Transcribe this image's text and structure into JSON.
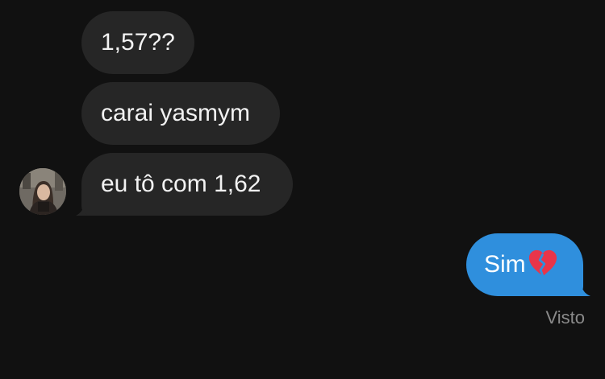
{
  "messages": [
    {
      "direction": "incoming",
      "text": "1,57??"
    },
    {
      "direction": "incoming",
      "text": "carai yasmym"
    },
    {
      "direction": "incoming",
      "text": "eu tô com 1,62"
    },
    {
      "direction": "outgoing",
      "text": "Sim",
      "emoji": "broken-heart-icon"
    }
  ],
  "status": "Visto",
  "colors": {
    "background": "#111111",
    "incoming_bubble": "#262626",
    "outgoing_bubble": "#2f8fdd",
    "status_text": "#8a8a8a"
  }
}
